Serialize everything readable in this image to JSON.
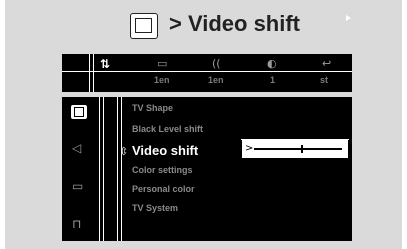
{
  "title": {
    "icon": "tv-shape-icon",
    "text": "> Video shift"
  },
  "topbar": {
    "items": [
      {
        "icon": "setup-icon",
        "glyph": "⇅",
        "value": "",
        "active": true
      },
      {
        "icon": "subtitle-icon",
        "glyph": "▭",
        "value": "1en",
        "active": false
      },
      {
        "icon": "audio-icon",
        "glyph": "((",
        "value": "1en",
        "active": false
      },
      {
        "icon": "angle-icon",
        "glyph": "◐",
        "value": "1",
        "active": false
      },
      {
        "icon": "program-icon",
        "glyph": "↩",
        "value": "st",
        "active": false
      }
    ]
  },
  "sidebar": {
    "items": [
      {
        "icon": "picture-icon",
        "active": true
      },
      {
        "icon": "speaker-icon",
        "glyph": "◁",
        "active": false
      },
      {
        "icon": "language-icon",
        "glyph": "▭",
        "active": false
      },
      {
        "icon": "features-icon",
        "glyph": "⊓",
        "active": false
      }
    ]
  },
  "menu": {
    "items": [
      {
        "label": "TV Shape",
        "selected": false
      },
      {
        "label": "Black Level shift",
        "selected": false
      },
      {
        "label": "Video shift",
        "selected": true
      },
      {
        "label": "Color settings",
        "selected": false
      },
      {
        "label": "Personal color",
        "selected": false
      },
      {
        "label": "TV System",
        "selected": false
      }
    ],
    "selected_marker": "⇳"
  },
  "slider": {
    "label": "Video shift",
    "pointer": ">",
    "value": 0.55
  }
}
